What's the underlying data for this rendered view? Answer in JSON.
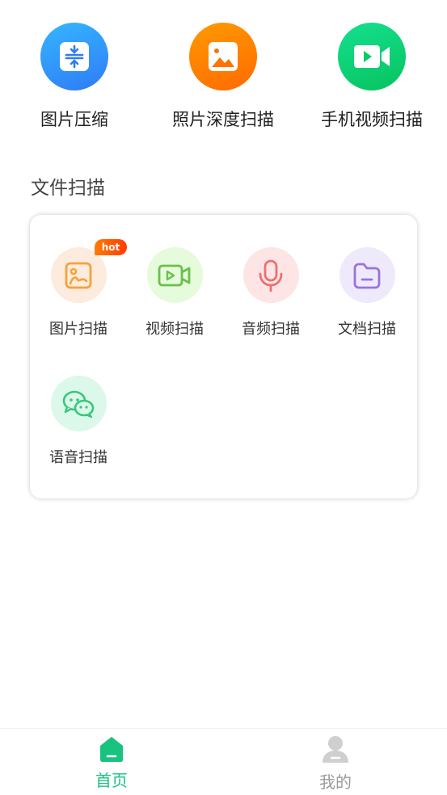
{
  "features": [
    {
      "label": "图片压缩",
      "icon": "compress-icon",
      "color": "#2f8cf8"
    },
    {
      "label": "照片深度扫描",
      "icon": "photo-icon",
      "color": "#ff8200"
    },
    {
      "label": "手机视频扫描",
      "icon": "video-camera-icon",
      "color": "#0fd27a"
    }
  ],
  "section": {
    "title": "文件扫描"
  },
  "tools": [
    {
      "label": "图片扫描",
      "icon": "image-icon",
      "badge": "hot",
      "color": "#f7a13b"
    },
    {
      "label": "视频扫描",
      "icon": "video-icon",
      "color": "#6cc04a"
    },
    {
      "label": "音频扫描",
      "icon": "microphone-icon",
      "color": "#ef6e6e"
    },
    {
      "label": "文档扫描",
      "icon": "folder-icon",
      "color": "#9a72e0"
    },
    {
      "label": "语音扫描",
      "icon": "wechat-icon",
      "color": "#35c87b"
    }
  ],
  "nav": {
    "home": {
      "label": "首页",
      "icon": "home-icon",
      "active": true,
      "color": "#17c37f"
    },
    "mine": {
      "label": "我的",
      "icon": "user-icon",
      "active": false,
      "color": "#cfcfcf"
    }
  }
}
